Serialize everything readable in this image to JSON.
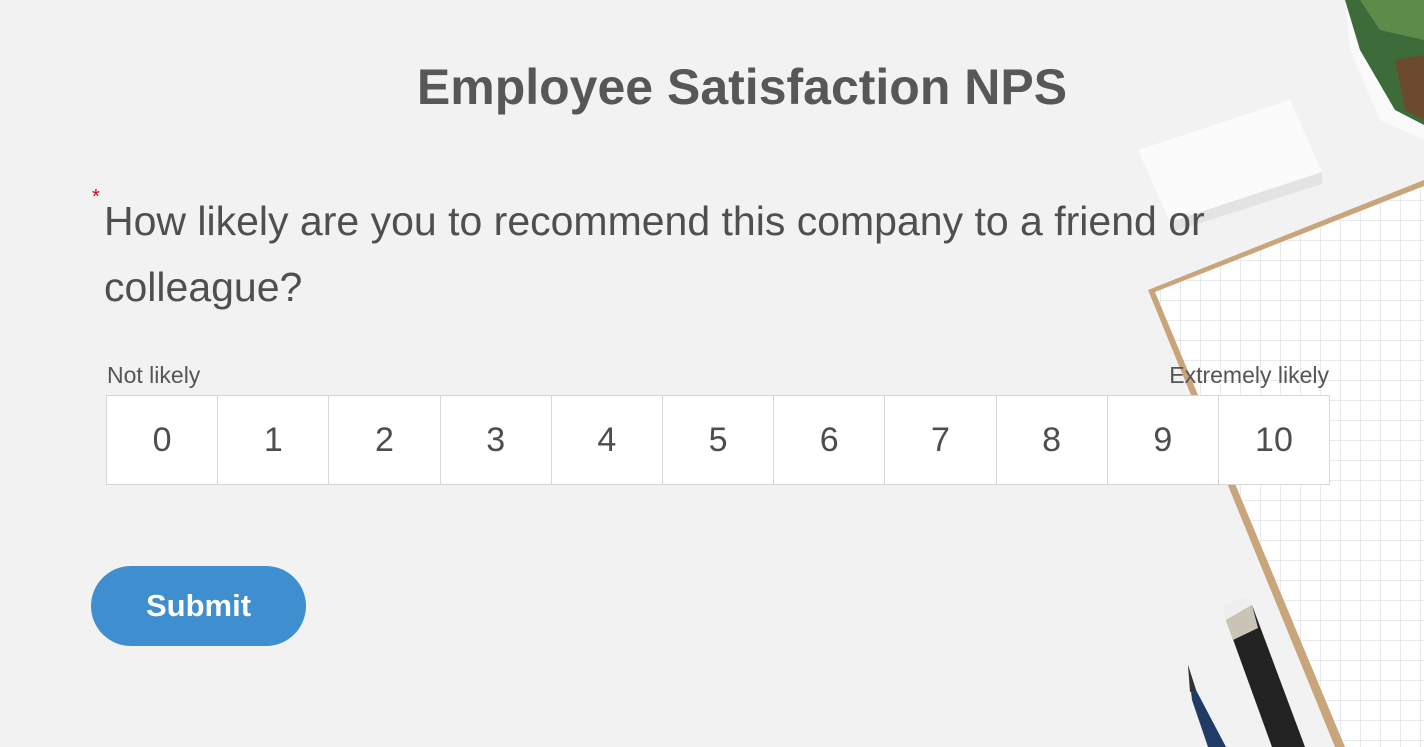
{
  "form": {
    "title": "Employee Satisfaction NPS",
    "required_marker": "*",
    "question": "How likely are you to recommend this company to a friend or colleague?",
    "low_label": "Not likely",
    "high_label": "Extremely likely",
    "options": [
      "0",
      "1",
      "2",
      "3",
      "4",
      "5",
      "6",
      "7",
      "8",
      "9",
      "10"
    ],
    "submit_label": "Submit"
  },
  "colors": {
    "background": "#f2f2f2",
    "title_text": "#575757",
    "required_marker": "#d0021b",
    "submit_button": "#3f8ecf"
  },
  "decor_icons": [
    "cactus-pot-icon",
    "eraser-icon",
    "grid-notebook-icon",
    "pencil-icon"
  ]
}
